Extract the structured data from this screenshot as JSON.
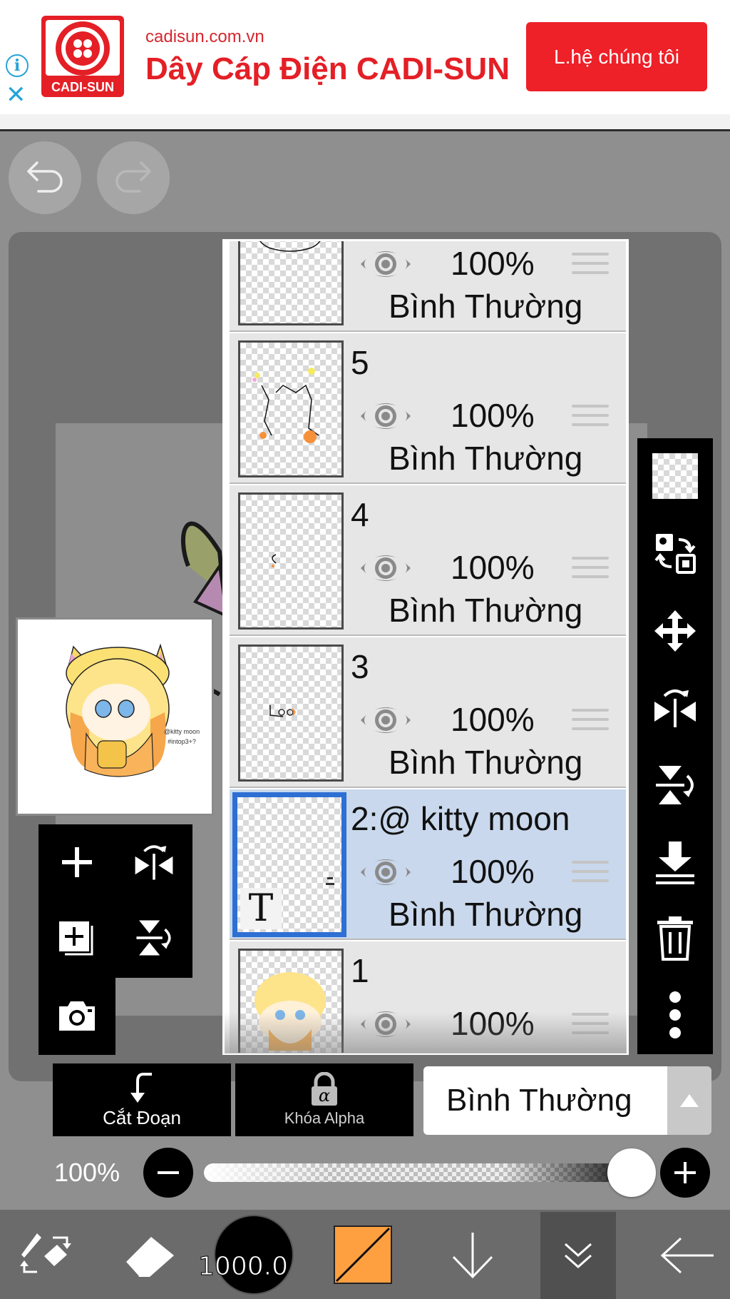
{
  "ad": {
    "url": "cadisun.com.vn",
    "title": "Dây Cáp Điện CADI-SUN",
    "cta": "L.hệ chúng tôi",
    "logo_text": "CADI-SUN",
    "info_icon": "i",
    "close_icon": "✕"
  },
  "layers": [
    {
      "name": "",
      "opacity": "100%",
      "blend": "Bình Thường",
      "selected": false
    },
    {
      "name": "5",
      "opacity": "100%",
      "blend": "Bình Thường",
      "selected": false
    },
    {
      "name": "4",
      "opacity": "100%",
      "blend": "Bình Thường",
      "selected": false
    },
    {
      "name": "3",
      "opacity": "100%",
      "blend": "Bình Thường",
      "selected": false
    },
    {
      "name": "2:@ kitty moon",
      "opacity": "100%",
      "blend": "Bình Thường",
      "selected": true
    },
    {
      "name": "1",
      "opacity": "100%",
      "blend": "",
      "selected": false
    }
  ],
  "text_layer_glyph": "T",
  "preview": {
    "caption": "@kitty moon\n#intop3+?"
  },
  "controls": {
    "clipping_label": "Cắt Đoạn",
    "alpha_lock_label": "Khóa Alpha",
    "alpha_glyph": "α",
    "blend_mode": "Bình Thường",
    "opacity_label": "100%",
    "opacity_value": 1.0
  },
  "bottom": {
    "brush_size": "1000.0",
    "color": "#ffa040"
  },
  "colors": {
    "ad_red": "#ee2028",
    "selection_blue": "#2d6fd3",
    "selected_row": "#c9d8ec"
  }
}
